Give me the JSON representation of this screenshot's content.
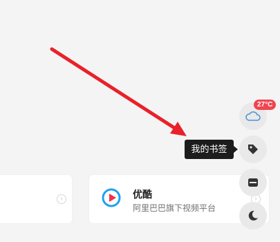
{
  "badge": {
    "temperature": "27°C"
  },
  "tooltip": {
    "label": "我的书签"
  },
  "card": {
    "title": "优酷",
    "subtitle": "阿里巴巴旗下视频平台"
  },
  "icons": {
    "weather": "cloud-icon",
    "bookmark": "tag-icon",
    "toolbox": "toolbox-icon",
    "theme": "moon-icon",
    "chevron": "chevron-right-icon"
  },
  "colors": {
    "accent_red": "#e8212b",
    "badge_red": "#f0454f",
    "youku_blue": "#1ea0f2",
    "youku_red": "#f0324b"
  }
}
